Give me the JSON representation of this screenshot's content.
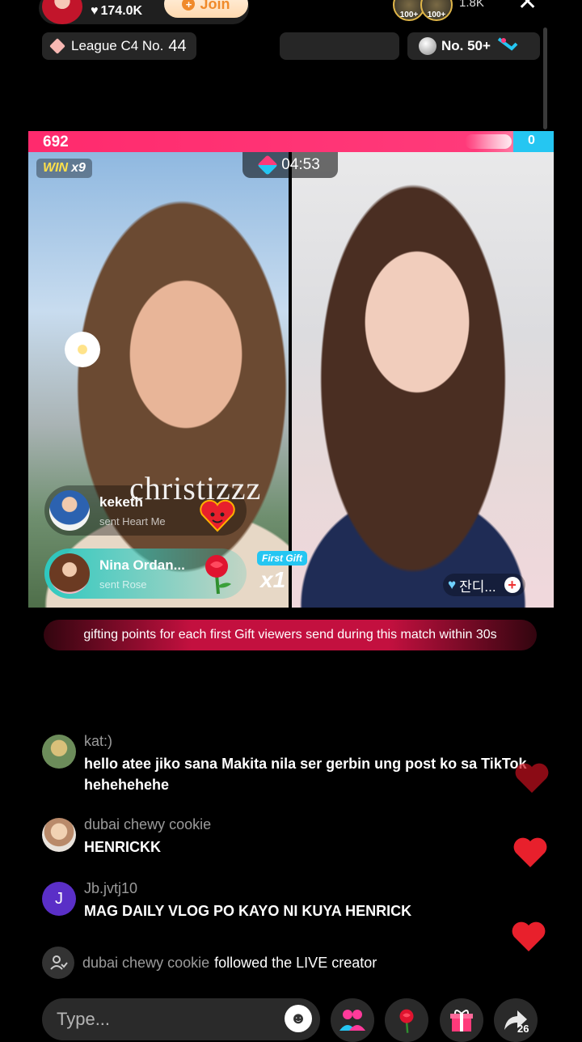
{
  "header": {
    "likes": "174.0K",
    "join_label": "Join",
    "viewer_badges": [
      "100+",
      "100+"
    ],
    "viewer_count": "1.8K",
    "league_prefix": "League C4 No.",
    "league_number": "44",
    "rank_label": "No. 50+"
  },
  "battle": {
    "score_left": "692",
    "score_right": "0",
    "win_label": "WIN",
    "win_streak": "x9",
    "timer": "04:53",
    "overlay_text": "christizzz",
    "gifts": [
      {
        "user": "keketh",
        "action": "sent Heart Me"
      },
      {
        "user": "Nina Ordan...",
        "action": "sent Rose"
      }
    ],
    "first_gift_label": "First Gift",
    "gift_multiplier": "x1",
    "right_host_tag": "잔디..."
  },
  "banner": {
    "text": "gifting points for each first Gift viewers send during this match within 30s"
  },
  "chat": [
    {
      "user": "kat:)",
      "message": "hello atee jiko sana Makita nila ser gerbin ung post ko sa TikTok hehehehehe"
    },
    {
      "user": "dubai chewy cookie",
      "message": "HENRICKK"
    },
    {
      "user": "Jb.jvtj10",
      "avatar_letter": "J",
      "message": "MAG DAILY VLOG PO KAYO NI KUYA HENRICK"
    }
  ],
  "follow_event": {
    "user": "dubai chewy cookie",
    "text": "followed the LIVE creator"
  },
  "bottom_bar": {
    "input_placeholder": "Type...",
    "share_count": "26"
  },
  "colors": {
    "red_team": "#ff2a6d",
    "blue_team": "#25c6f2",
    "banner": "#c3103f",
    "heart": "#e8202c"
  },
  "icons": [
    "heart-icon",
    "close-icon",
    "gem-icon",
    "medal-icon",
    "timer-icon",
    "rose-icon",
    "plus-icon",
    "person-icon",
    "smile-icon",
    "group-icon",
    "gift-icon",
    "share-icon"
  ]
}
